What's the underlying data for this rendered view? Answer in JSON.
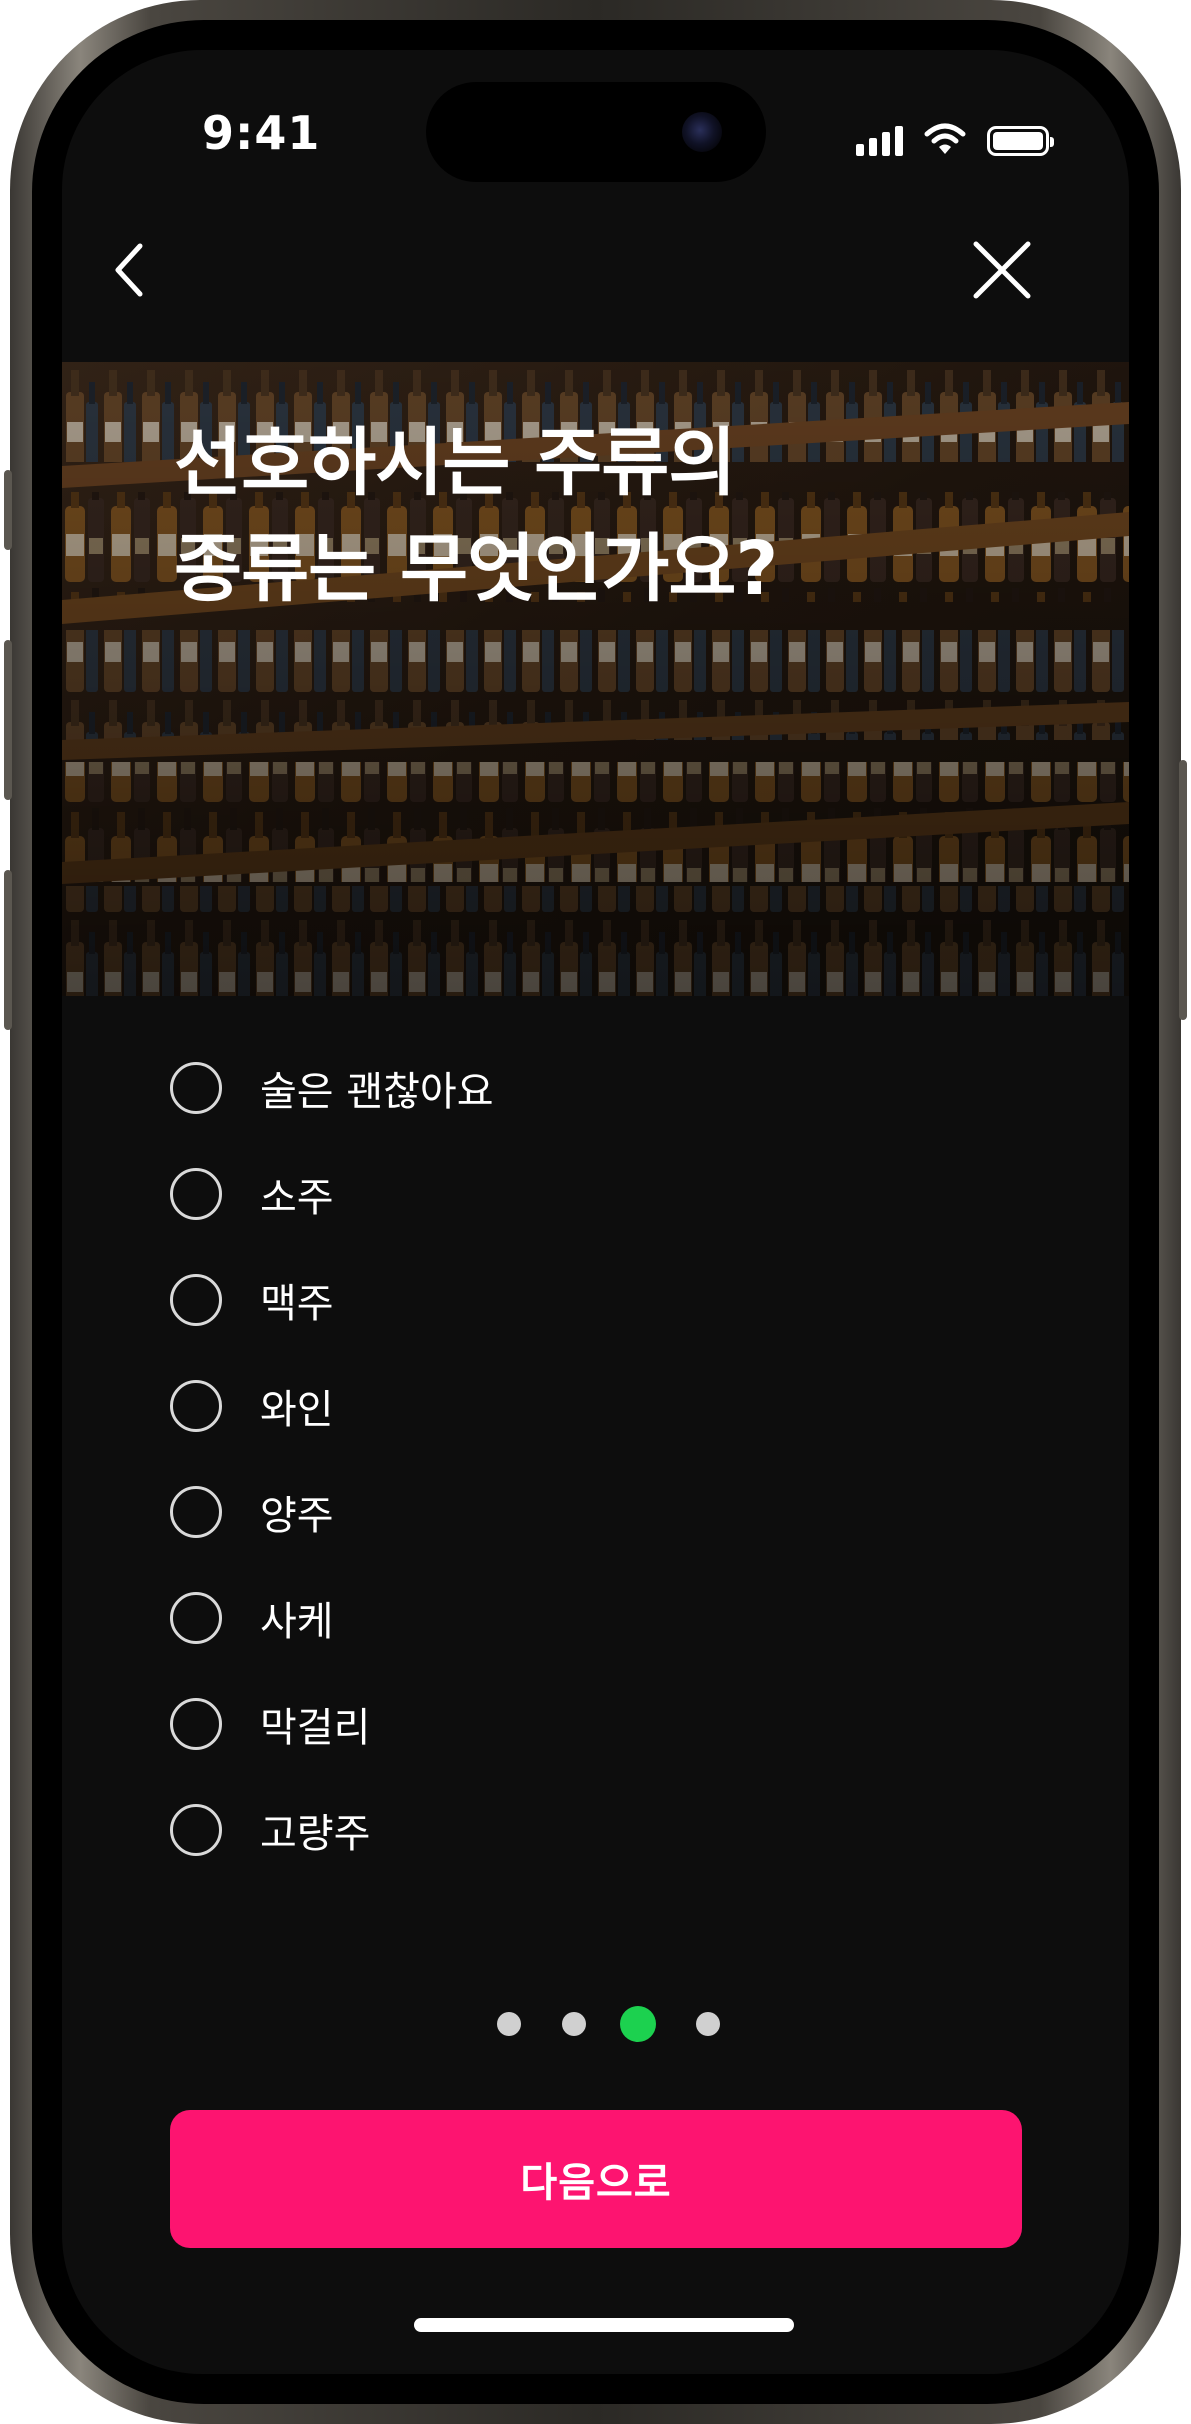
{
  "status_bar": {
    "time": "9:41"
  },
  "nav": {
    "back_icon": "chevron-left-icon",
    "close_icon": "close-icon"
  },
  "hero": {
    "title_line1": "선호하시는 주류의",
    "title_line2": "종류는 무엇인가요?"
  },
  "options": [
    {
      "label": "술은 괜찮아요",
      "selected": false
    },
    {
      "label": "소주",
      "selected": false
    },
    {
      "label": "맥주",
      "selected": false
    },
    {
      "label": "와인",
      "selected": false
    },
    {
      "label": "양주",
      "selected": false
    },
    {
      "label": "사케",
      "selected": false
    },
    {
      "label": "막걸리",
      "selected": false
    },
    {
      "label": "고량주",
      "selected": false
    }
  ],
  "pager": {
    "total": 4,
    "current": 3
  },
  "next_button": {
    "label": "다음으로"
  },
  "colors": {
    "background": "#0d0d0d",
    "accent": "#fd1470",
    "pager_active": "#1cd14f",
    "pager_inactive": "#d0d0d0"
  }
}
